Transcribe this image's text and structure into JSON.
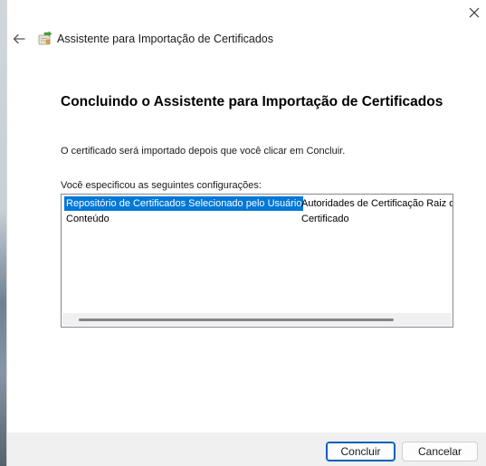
{
  "window": {
    "title": "Assistente para Importação de Certificados",
    "icons": {
      "close": "close-icon",
      "back": "back-arrow-icon",
      "wizard": "certificate-wizard-icon"
    }
  },
  "page": {
    "heading": "Concluindo o Assistente para Importação de Certificados",
    "intro": "O certificado será importado depois que você clicar em Concluir.",
    "config_label": "Você especificou as seguintes configurações:"
  },
  "settings": {
    "rows": [
      {
        "name": "Repositório de Certificados Selecionado pelo Usuário",
        "value": "Autoridades de Certificação Raiz d",
        "selected": true
      },
      {
        "name": "Conteúdo",
        "value": "Certificado",
        "selected": false
      }
    ]
  },
  "buttons": {
    "finish": "Concluir",
    "cancel": "Cancelar"
  },
  "colors": {
    "selection": "#0078d7",
    "primary_border": "#005fb8",
    "footer_bg": "#f0f0f0"
  }
}
